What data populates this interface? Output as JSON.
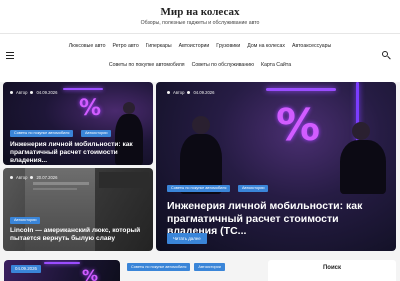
{
  "site": {
    "title": "Мир на колесах",
    "tagline": "Обзоры, полезные гаджеты и обслуживание авто"
  },
  "nav": {
    "row1": [
      "Люксовые авто",
      "Ретро авто",
      "Гиперкары",
      "Автоистории",
      "Грузовики",
      "Дом на колесах",
      "Автоаксессуары"
    ],
    "row2": [
      "Советы по покупке автомобиля",
      "Советы по обслуживанию",
      "Карта Сайта"
    ]
  },
  "icons": {
    "menu": "hamburger-menu-icon",
    "search": "search-icon",
    "author": "user-icon"
  },
  "posts": {
    "small1": {
      "author": "Автор",
      "date": "04.09.2026",
      "categories": [
        "Советы по покупке автомобиля",
        "Автоистории"
      ],
      "title": "Инженерия личной мобильности: как прагматичный расчет стоимости владения..."
    },
    "small2": {
      "author": "Автор",
      "date": "20.07.2026",
      "categories": [
        "Автоистории"
      ],
      "title": "Lincoln — американский люкс, который пытается вернуть былую славу"
    },
    "featured": {
      "author": "Автор",
      "date": "04.09.2026",
      "categories": [
        "Советы по покупке автомобиля",
        "Автоистории"
      ],
      "title": "Инженерия личной мобильности: как прагматичный расчет стоимости владения (TC...",
      "button": "Читать далее"
    },
    "bottom": {
      "date": "04.09.2026",
      "categories": [
        "Советы по покупке автомобиля",
        "Автоистории"
      ]
    }
  },
  "widgets": {
    "search_title": "Поиск"
  },
  "colors": {
    "accent": "#3a85d8",
    "dark_card": "#121126",
    "neon_purple": "#d15cff"
  }
}
